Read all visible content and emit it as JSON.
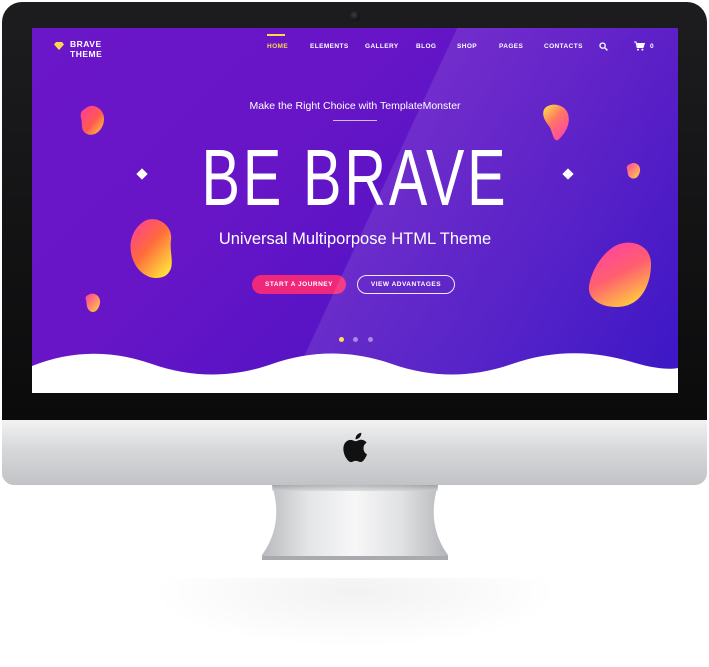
{
  "site": {
    "logo": {
      "line1": "BRAVE",
      "line2": "THEME"
    },
    "nav": [
      {
        "label": "HOME",
        "active": true
      },
      {
        "label": "ELEMENTS",
        "active": false
      },
      {
        "label": "GALLERY",
        "active": false
      },
      {
        "label": "BLOG",
        "active": false
      },
      {
        "label": "SHOP",
        "active": false
      },
      {
        "label": "PAGES",
        "active": false
      },
      {
        "label": "CONTACTS",
        "active": false
      }
    ],
    "cart_count": "0",
    "icons": {
      "search": "search-icon",
      "cart": "cart-icon",
      "logo": "diamond-logo-icon",
      "device": "apple-logo-icon"
    }
  },
  "hero": {
    "tagline": "Make the Right Choice with TemplateMonster",
    "title": "BE BRAVE",
    "subtitle": "Universal Multiporpose HTML Theme",
    "primary_button": "START A JOURNEY",
    "secondary_button": "VIEW ADVANTAGES",
    "slides": 3,
    "active_slide": 1
  },
  "colors": {
    "gradient_start": "#6a16c9",
    "gradient_end": "#3a17c6",
    "accent_pink": "#f0287b",
    "accent_yellow": "#ffd84a",
    "text": "#ffffff"
  }
}
